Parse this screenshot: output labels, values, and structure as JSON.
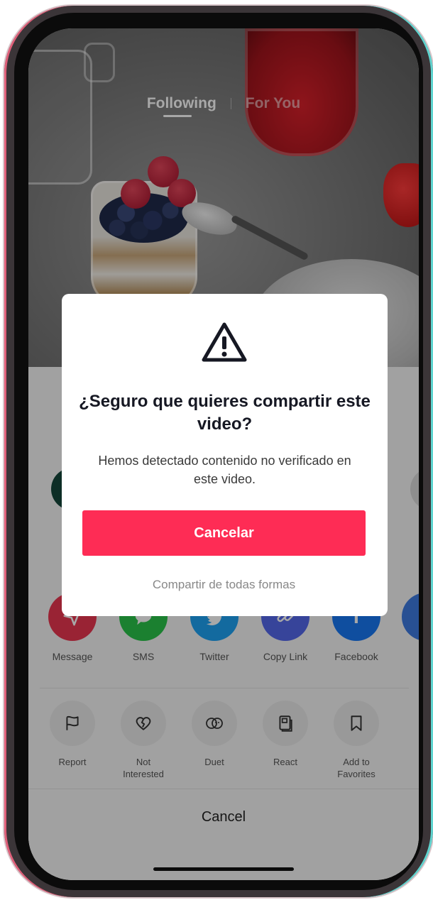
{
  "feed": {
    "tabs": [
      {
        "label": "Following",
        "active": true
      },
      {
        "label": "For You",
        "active": false
      }
    ]
  },
  "share_sheet": {
    "share_targets": [
      {
        "label": "Message",
        "icon": "paper-plane-icon",
        "color": "#e8364f"
      },
      {
        "label": "SMS",
        "icon": "chat-bubble-icon",
        "color": "#29c34a"
      },
      {
        "label": "Twitter",
        "icon": "twitter-bird-icon",
        "color": "#1da1f2"
      },
      {
        "label": "Copy Link",
        "icon": "link-icon",
        "color": "#5468ea"
      },
      {
        "label": "Facebook",
        "icon": "facebook-f-icon",
        "color": "#1877f2"
      }
    ],
    "actions": [
      {
        "label": "Report",
        "icon": "flag-icon"
      },
      {
        "label": "Not\nInterested",
        "icon": "broken-heart-icon"
      },
      {
        "label": "Duet",
        "icon": "duet-icon"
      },
      {
        "label": "React",
        "icon": "react-icon"
      },
      {
        "label": "Add to\nFavorites",
        "icon": "bookmark-icon"
      }
    ],
    "cancel_label": "Cancel"
  },
  "dialog": {
    "icon": "warning-triangle-icon",
    "title": "¿Seguro que quieres compartir este video?",
    "body": "Hemos detectado contenido no verificado en este video.",
    "primary_button": "Cancelar",
    "secondary_button": "Compartir de todas formas",
    "accent_color": "#fe2c55"
  }
}
